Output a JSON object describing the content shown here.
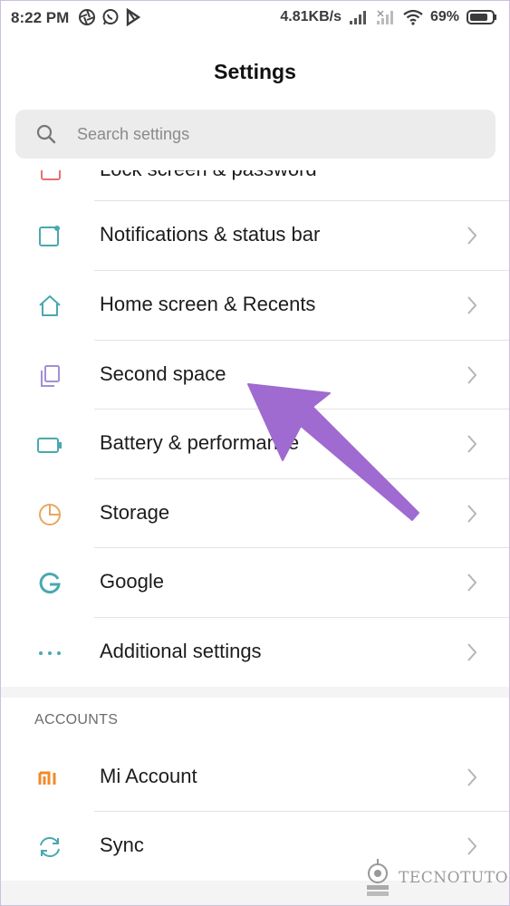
{
  "status": {
    "time": "8:22 PM",
    "speed": "4.81KB/s",
    "battery": "69%"
  },
  "header": {
    "title": "Settings"
  },
  "search": {
    "placeholder": "Search settings"
  },
  "partial_item": {
    "label": "Lock screen & password"
  },
  "items": [
    {
      "label": "Notifications & status bar",
      "icon": "notification-icon"
    },
    {
      "label": "Home screen & Recents",
      "icon": "home-icon"
    },
    {
      "label": "Second space",
      "icon": "second-space-icon"
    },
    {
      "label": "Battery & performance",
      "icon": "battery-icon"
    },
    {
      "label": "Storage",
      "icon": "storage-icon"
    },
    {
      "label": "Google",
      "icon": "google-icon"
    },
    {
      "label": "Additional settings",
      "icon": "more-icon"
    }
  ],
  "accounts": {
    "section_title": "ACCOUNTS",
    "items": [
      {
        "label": "Mi Account",
        "icon": "mi-icon"
      },
      {
        "label": "Sync",
        "icon": "sync-icon"
      }
    ]
  },
  "watermark": {
    "text": "TECNOTUTO"
  },
  "colors": {
    "accent": "#4aa8b0",
    "arrow": "#9b6bd3"
  }
}
